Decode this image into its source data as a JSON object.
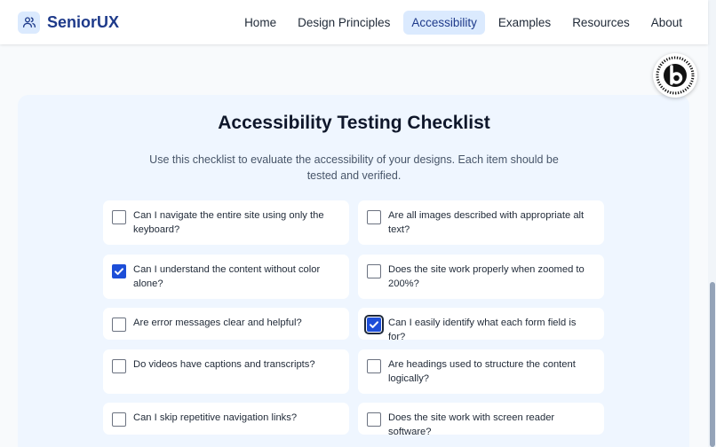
{
  "header": {
    "brand": "SeniorUX",
    "nav": [
      "Home",
      "Design Principles",
      "Accessibility",
      "Examples",
      "Resources",
      "About"
    ],
    "active_nav": "Accessibility"
  },
  "badge": {
    "text": "POWERED BY BOLT · NEW · MADE IN BOLT",
    "icon": "bolt-b-icon"
  },
  "checklist": {
    "title": "Accessibility Testing Checklist",
    "intro": "Use this checklist to evaluate the accessibility of your designs. Each item should be tested and verified.",
    "items": [
      {
        "label": "Can I navigate the entire site using only the keyboard?",
        "checked": false
      },
      {
        "label": "Are all images described with appropriate alt text?",
        "checked": false
      },
      {
        "label": "Can I understand the content without color alone?",
        "checked": true
      },
      {
        "label": "Does the site work properly when zoomed to 200%?",
        "checked": false
      },
      {
        "label": "Are error messages clear and helpful?",
        "checked": false
      },
      {
        "label": "Can I easily identify what each form field is for?",
        "checked": true,
        "focused": true
      },
      {
        "label": "Do videos have captions and transcripts?",
        "checked": false
      },
      {
        "label": "Are headings used to structure the content logically?",
        "checked": false
      },
      {
        "label": "Can I skip repetitive navigation links?",
        "checked": false
      },
      {
        "label": "Does the site work with screen reader software?",
        "checked": false
      }
    ]
  },
  "colors": {
    "accent": "#1d4ed8",
    "brand": "#1e3a8a",
    "panel": "#eff6ff",
    "active_nav_bg": "#dbeafe"
  }
}
